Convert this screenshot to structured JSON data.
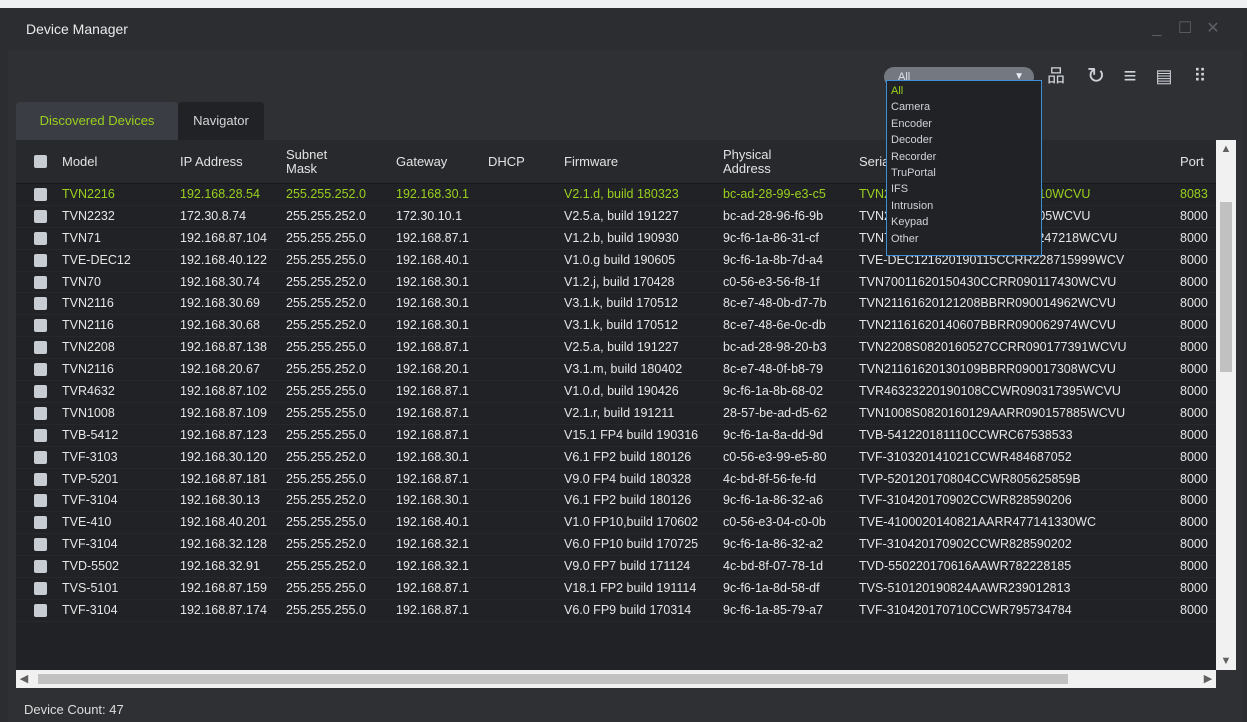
{
  "window": {
    "title": "Device Manager"
  },
  "toolbar": {
    "filter_value": "All",
    "icons": [
      "network-tree-icon",
      "refresh-icon",
      "add-list-icon",
      "document-icon",
      "grid-menu-icon"
    ]
  },
  "filter_options": [
    "All",
    "Camera",
    "Encoder",
    "Decoder",
    "Recorder",
    "TruPortal",
    "IFS",
    "Intrusion",
    "Keypad",
    "Other"
  ],
  "tabs": [
    "Discovered Devices",
    "Navigator"
  ],
  "columns": {
    "model": "Model",
    "ip": "IP Address",
    "subnet": "Subnet Mask",
    "gateway": "Gateway",
    "dhcp": "DHCP",
    "firmware": "Firmware",
    "physical": "Physical Address",
    "serial": "Seria",
    "port": "Port"
  },
  "rows": [
    {
      "model": "TVN2216",
      "ip": "192.168.28.54",
      "subnet": "255.255.252.0",
      "gateway": "192.168.30.1",
      "dhcp": "",
      "firmware": "V2.1.d, build 180323",
      "mac": "bc-ad-28-99-e3-c5",
      "serial": "TVN2216160128CCRR090177810WCVU",
      "port": "8083",
      "highlight": true
    },
    {
      "model": "TVN2232",
      "ip": "172.30.8.74",
      "subnet": "255.255.252.0",
      "gateway": "172.30.10.1",
      "dhcp": "",
      "firmware": "V2.5.a, build 191227",
      "mac": "bc-ad-28-96-f6-9b",
      "serial": "TVN2232160128CCRR090176605WCVU",
      "port": "8000"
    },
    {
      "model": "TVN71",
      "ip": "192.168.87.104",
      "subnet": "255.255.255.0",
      "gateway": "192.168.87.1",
      "dhcp": "",
      "firmware": "V1.2.b, build 190930",
      "mac": "9c-f6-1a-86-31-cf",
      "serial": "TVN71161620190128CCRR090247218WCVU",
      "port": "8000"
    },
    {
      "model": "TVE-DEC12",
      "ip": "192.168.40.122",
      "subnet": "255.255.255.0",
      "gateway": "192.168.40.1",
      "dhcp": "",
      "firmware": "V1.0.g build 190605",
      "mac": "9c-f6-1a-8b-7d-a4",
      "serial": "TVE-DEC121620190115CCRR228715999WCV",
      "port": "8000"
    },
    {
      "model": "TVN70",
      "ip": "192.168.30.74",
      "subnet": "255.255.252.0",
      "gateway": "192.168.30.1",
      "dhcp": "",
      "firmware": "V1.2.j, build 170428",
      "mac": "c0-56-e3-56-f8-1f",
      "serial": "TVN70011620150430CCRR090117430WCVU",
      "port": "8000"
    },
    {
      "model": "TVN2116",
      "ip": "192.168.30.69",
      "subnet": "255.255.252.0",
      "gateway": "192.168.30.1",
      "dhcp": "",
      "firmware": "V3.1.k, build 170512",
      "mac": "8c-e7-48-0b-d7-7b",
      "serial": "TVN21161620121208BBRR090014962WCVU",
      "port": "8000"
    },
    {
      "model": "TVN2116",
      "ip": "192.168.30.68",
      "subnet": "255.255.252.0",
      "gateway": "192.168.30.1",
      "dhcp": "",
      "firmware": "V3.1.k, build 170512",
      "mac": "8c-e7-48-6e-0c-db",
      "serial": "TVN21161620140607BBRR090062974WCVU",
      "port": "8000"
    },
    {
      "model": "TVN2208",
      "ip": "192.168.87.138",
      "subnet": "255.255.255.0",
      "gateway": "192.168.87.1",
      "dhcp": "",
      "firmware": "V2.5.a, build 191227",
      "mac": "bc-ad-28-98-20-b3",
      "serial": "TVN2208S0820160527CCRR090177391WCVU",
      "port": "8000"
    },
    {
      "model": "TVN2116",
      "ip": "192.168.20.67",
      "subnet": "255.255.252.0",
      "gateway": "192.168.20.1",
      "dhcp": "",
      "firmware": "V3.1.m, build 180402",
      "mac": "8c-e7-48-0f-b8-79",
      "serial": "TVN21161620130109BBRR090017308WCVU",
      "port": "8000"
    },
    {
      "model": "TVR4632",
      "ip": "192.168.87.102",
      "subnet": "255.255.255.0",
      "gateway": "192.168.87.1",
      "dhcp": "",
      "firmware": "V1.0.d, build 190426",
      "mac": "9c-f6-1a-8b-68-02",
      "serial": "TVR46323220190108CCWR090317395WCVU",
      "port": "8000"
    },
    {
      "model": "TVN1008",
      "ip": "192.168.87.109",
      "subnet": "255.255.255.0",
      "gateway": "192.168.87.1",
      "dhcp": "",
      "firmware": "V2.1.r, build 191211",
      "mac": "28-57-be-ad-d5-62",
      "serial": "TVN1008S0820160129AARR090157885WCVU",
      "port": "8000"
    },
    {
      "model": "TVB-5412",
      "ip": "192.168.87.123",
      "subnet": "255.255.255.0",
      "gateway": "192.168.87.1",
      "dhcp": "",
      "firmware": "V15.1 FP4 build 190316",
      "mac": "9c-f6-1a-8a-dd-9d",
      "serial": "TVB-541220181110CCWRC67538533",
      "port": "8000"
    },
    {
      "model": "TVF-3103",
      "ip": "192.168.30.120",
      "subnet": "255.255.252.0",
      "gateway": "192.168.30.1",
      "dhcp": "",
      "firmware": "V6.1 FP2 build 180126",
      "mac": "c0-56-e3-99-e5-80",
      "serial": "TVF-310320141021CCWR484687052",
      "port": "8000"
    },
    {
      "model": "TVP-5201",
      "ip": "192.168.87.181",
      "subnet": "255.255.255.0",
      "gateway": "192.168.87.1",
      "dhcp": "",
      "firmware": "V9.0 FP4 build 180328",
      "mac": "4c-bd-8f-56-fe-fd",
      "serial": "TVP-520120170804CCWR805625859B",
      "port": "8000"
    },
    {
      "model": "TVF-3104",
      "ip": "192.168.30.13",
      "subnet": "255.255.252.0",
      "gateway": "192.168.30.1",
      "dhcp": "",
      "firmware": "V6.1 FP2 build 180126",
      "mac": "9c-f6-1a-86-32-a6",
      "serial": "TVF-310420170902CCWR828590206",
      "port": "8000"
    },
    {
      "model": "TVE-410",
      "ip": "192.168.40.201",
      "subnet": "255.255.255.0",
      "gateway": "192.168.40.1",
      "dhcp": "",
      "firmware": "V1.0 FP10,build 170602",
      "mac": "c0-56-e3-04-c0-0b",
      "serial": "TVE-4100020140821AARR477141330WC",
      "port": "8000"
    },
    {
      "model": "TVF-3104",
      "ip": "192.168.32.128",
      "subnet": "255.255.252.0",
      "gateway": "192.168.32.1",
      "dhcp": "",
      "firmware": "V6.0 FP10 build 170725",
      "mac": "9c-f6-1a-86-32-a2",
      "serial": "TVF-310420170902CCWR828590202",
      "port": "8000"
    },
    {
      "model": "TVD-5502",
      "ip": "192.168.32.91",
      "subnet": "255.255.252.0",
      "gateway": "192.168.32.1",
      "dhcp": "",
      "firmware": "V9.0 FP7 build 171124",
      "mac": "4c-bd-8f-07-78-1d",
      "serial": "TVD-550220170616AAWR782228185",
      "port": "8000"
    },
    {
      "model": "TVS-5101",
      "ip": "192.168.87.159",
      "subnet": "255.255.255.0",
      "gateway": "192.168.87.1",
      "dhcp": "",
      "firmware": "V18.1 FP2 build 191114",
      "mac": "9c-f6-1a-8d-58-df",
      "serial": "TVS-510120190824AAWR239012813",
      "port": "8000"
    },
    {
      "model": "TVF-3104",
      "ip": "192.168.87.174",
      "subnet": "255.255.255.0",
      "gateway": "192.168.87.1",
      "dhcp": "",
      "firmware": "V6.0 FP9 build 170314",
      "mac": "9c-f6-1a-85-79-a7",
      "serial": "TVF-310420170710CCWR795734784",
      "port": "8000"
    }
  ],
  "status": {
    "device_count": "Device Count: 47"
  },
  "colors": {
    "accent": "#9ad11e",
    "dropdown_border": "#3f8fd8"
  }
}
